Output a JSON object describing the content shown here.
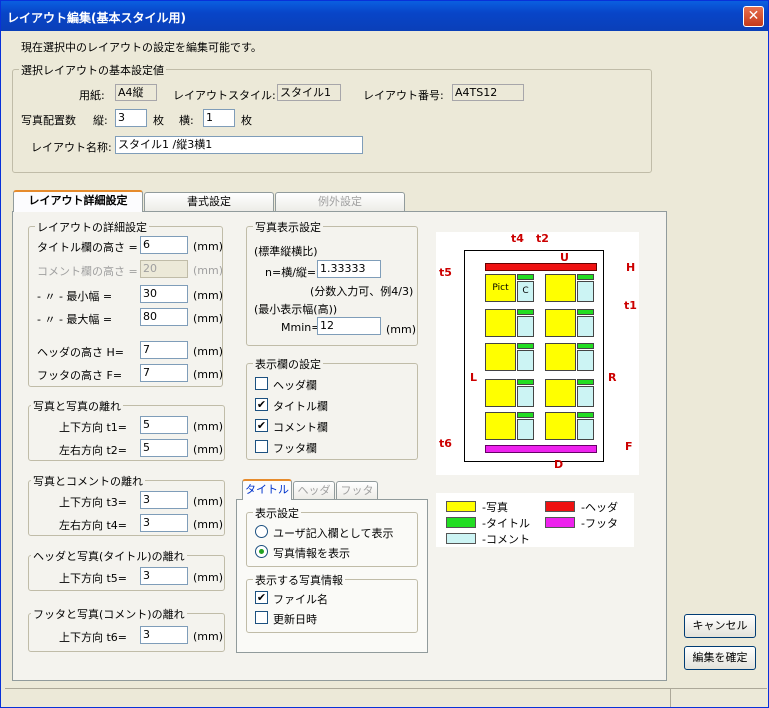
{
  "window": {
    "title": "レイアウト編集(基本スタイル用)",
    "close": "✕"
  },
  "info_text": "現在選択中のレイアウトの設定を編集可能です。",
  "basic": {
    "group": "選択レイアウトの基本設定値",
    "paper_label": "用紙:",
    "paper_value": "A4縦",
    "style_label": "レイアウトスタイル:",
    "style_value": "スタイル1",
    "number_label": "レイアウト番号:",
    "number_value": "A4TS12",
    "count_label": "写真配置数",
    "vert_label": "縦:",
    "vert_value": "3",
    "unit1": "枚",
    "horiz_label": "横:",
    "horiz_value": "1",
    "unit2": "枚",
    "name_label": "レイアウト名称:",
    "name_value": "スタイル1 /縦3横1"
  },
  "tabs": [
    "レイアウト詳細設定",
    "書式設定",
    "例外設定"
  ],
  "detail": {
    "group": "レイアウトの詳細設定",
    "rows": [
      {
        "label": "タイトル欄の高さ =",
        "value": "6",
        "unit": "(mm)"
      },
      {
        "label": "コメント欄の高さ =",
        "value": "20",
        "unit": "(mm)"
      },
      {
        "label": "- 〃 - 最小幅 =",
        "value": "30",
        "unit": "(mm)"
      },
      {
        "label": "- 〃 - 最大幅 =",
        "value": "80",
        "unit": "(mm)"
      },
      {
        "label": "ヘッダの高さ H=",
        "value": "7",
        "unit": "(mm)"
      },
      {
        "label": "フッタの高さ F=",
        "value": "7",
        "unit": "(mm)"
      }
    ]
  },
  "gap_photo": {
    "group": "写真と写真の離れ",
    "r1_label": "上下方向 t1=",
    "r1_value": "5",
    "r2_label": "左右方向 t2=",
    "r2_value": "5",
    "unit": "(mm)"
  },
  "gap_comment": {
    "group": "写真とコメントの離れ",
    "r1_label": "上下方向 t3=",
    "r1_value": "3",
    "r2_label": "左右方向 t4=",
    "r2_value": "3",
    "unit": "(mm)"
  },
  "gap_header": {
    "group": "ヘッダと写真(タイトル)の離れ",
    "label": "上下方向 t5=",
    "value": "3",
    "unit": "(mm)"
  },
  "gap_footer": {
    "group": "フッタと写真(コメント)の離れ",
    "label": "上下方向 t6=",
    "value": "3",
    "unit": "(mm)"
  },
  "photo_display": {
    "group": "写真表示設定",
    "ratio_label": "(標準縦横比)",
    "ratio_eq": "n=横/縦=",
    "ratio_value": "1.33333",
    "ratio_note": "(分数入力可、例4/3)",
    "min_label": "(最小表示幅(高))",
    "min_eq": "Mmin=",
    "min_value": "12",
    "unit": "(mm)"
  },
  "display_cols": {
    "group": "表示欄の設定",
    "items": [
      {
        "label": "ヘッダ欄",
        "checked": ""
      },
      {
        "label": "タイトル欄",
        "checked": "✔"
      },
      {
        "label": "コメント欄",
        "checked": "✔"
      },
      {
        "label": "フッタ欄",
        "checked": ""
      }
    ]
  },
  "subtabs": [
    "タイトル",
    "ヘッダ",
    "フッタ"
  ],
  "display_setting": {
    "group": "表示設定",
    "opt1": "ユーザ記入欄として表示",
    "opt2": "写真情報を表示"
  },
  "photo_info": {
    "group": "表示する写真情報",
    "items": [
      {
        "label": "ファイル名",
        "checked": "✔"
      },
      {
        "label": "更新日時",
        "checked": ""
      }
    ]
  },
  "diagram": {
    "labels": {
      "t4": "t4",
      "t2": "t2",
      "u": "U",
      "h": "H",
      "t5": "t5",
      "t1": "t1",
      "l": "L",
      "r": "R",
      "t6": "t6",
      "f": "F",
      "d": "D"
    },
    "pict": "Pict",
    "c": "C"
  },
  "legend": {
    "photo": "-写真",
    "header": "-ヘッダ",
    "title": "-タイトル",
    "footer": "-フッタ",
    "comment": "-コメント",
    "colors": {
      "photo": "#ffff00",
      "header": "#ee1111",
      "title": "#22dd22",
      "footer": "#ee22ee",
      "comment": "#ccf4f4"
    }
  },
  "buttons": {
    "cancel": "キャンセル",
    "confirm": "編集を確定"
  }
}
